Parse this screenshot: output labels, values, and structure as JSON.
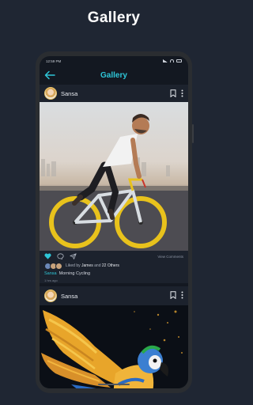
{
  "promo": {
    "title": "Gallery"
  },
  "status": {
    "time": "12:59 PM"
  },
  "app": {
    "title": "Gallery"
  },
  "posts": [
    {
      "user": "Sansa",
      "view_comments": "View Comments",
      "liked_prefix": "Liked by",
      "liked_name": "James",
      "liked_mid": "and",
      "liked_others": "22 Others",
      "caption_user": "Sansa",
      "caption_text": "Morning Cycling",
      "time_ago": "1 hrs ago",
      "liked": true
    },
    {
      "user": "Sansa"
    }
  ],
  "colors": {
    "accent": "#2ec6d8",
    "background": "#1f2633",
    "card": "#1c222d"
  },
  "icons": [
    "back-arrow-icon",
    "bookmark-icon",
    "more-vertical-icon",
    "heart-icon",
    "comment-icon",
    "share-icon"
  ]
}
